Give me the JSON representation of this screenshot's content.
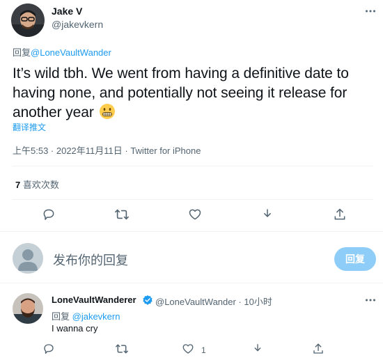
{
  "tweet": {
    "author_name": "Jake V",
    "author_handle": "@jakevkern",
    "reply_prefix": "回复",
    "reply_to": "@LoneVaultWander",
    "text": "It’s wild tbh. We went from having a definitive date to having none, and potentially not seeing it release for another year",
    "emoji": "grimacing-face",
    "translate_label": "翻译推文",
    "meta": "上午5:53 · 2022年11月11日 · Twitter for iPhone",
    "likes_count": "7",
    "likes_label": "喜欢次数",
    "actions": [
      "reply-icon",
      "retweet-icon",
      "like-icon",
      "bookmark-icon",
      "share-icon"
    ]
  },
  "compose": {
    "placeholder": "发布你的回复",
    "button_label": "回复"
  },
  "reply": {
    "author_name": "LoneVaultWanderer",
    "author_handle": "@LoneVaultWander · 10小时",
    "reply_prefix": "回复",
    "reply_to": "@jakevkern",
    "text": "I wanna cry",
    "like_count": "1"
  },
  "colors": {
    "link": "#1d9bf0",
    "muted": "#536471",
    "button_disabled": "#8ecdf8",
    "divider": "#eff3f4"
  }
}
